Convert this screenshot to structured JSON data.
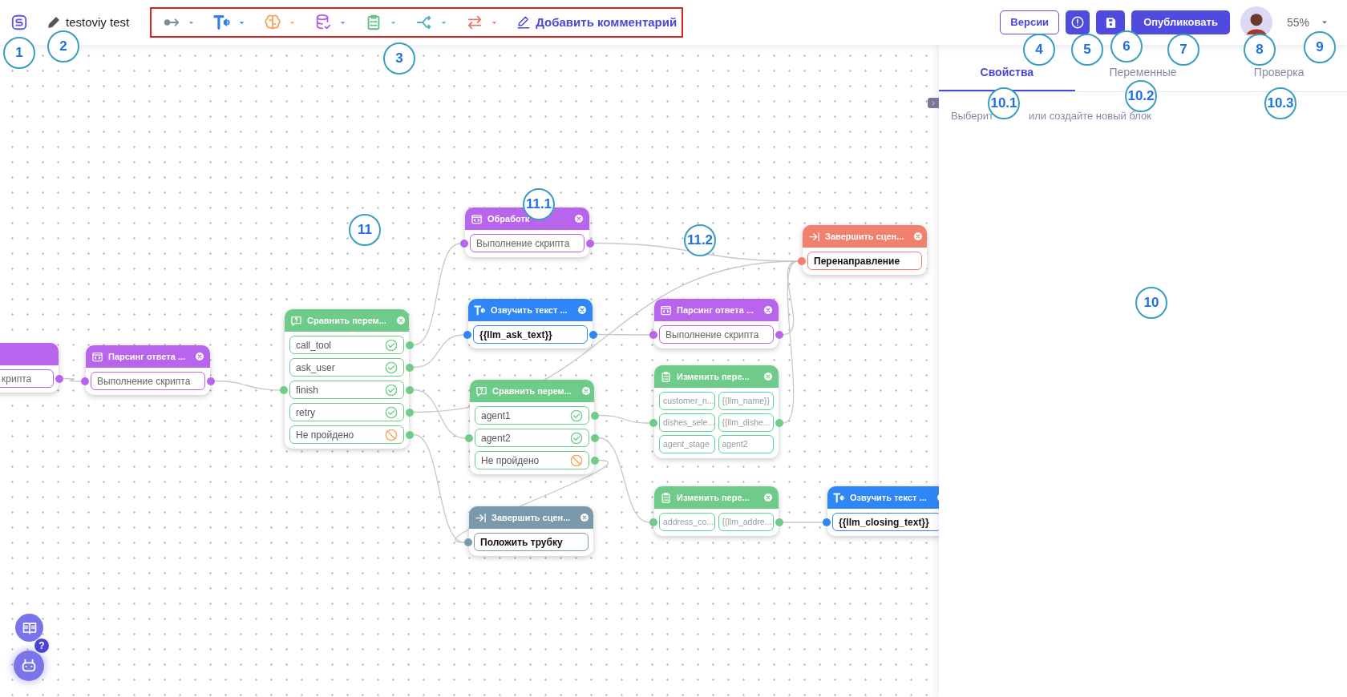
{
  "header": {
    "title": "testoviy test",
    "tools": [
      {
        "kind": "transfer",
        "color": "#78909c"
      },
      {
        "kind": "speak",
        "color": "#2f80ed"
      },
      {
        "kind": "ai",
        "color": "#f6a356"
      },
      {
        "kind": "database",
        "color": "#b35ee6"
      },
      {
        "kind": "variables",
        "color": "#5ec27e"
      },
      {
        "kind": "branch",
        "color": "#4aaec4"
      },
      {
        "kind": "switch",
        "color": "#f07469"
      }
    ],
    "comment_button": "Добавить комментарий",
    "versions_button": "Версии",
    "publish_button": "Опубликовать",
    "zoom": "55%"
  },
  "panel": {
    "tabs": [
      {
        "label": "Свойства",
        "selected": true
      },
      {
        "label": "Переменные",
        "selected": false
      },
      {
        "label": "Проверка",
        "selected": false
      }
    ],
    "hint": [
      "Выберит",
      "или создайте новый блок"
    ]
  },
  "nodes": [
    {
      "kind": "script",
      "color": "#b964ec",
      "fields": [
        "крипта"
      ]
    },
    {
      "kind": "script",
      "color": "#b964ec",
      "title": "Парсинг ответа ...",
      "fields": [
        "Выполнение скрипта"
      ]
    },
    {
      "kind": "compare",
      "color": "#6fcb8a",
      "title": "Сравнить перем...",
      "rows": [
        {
          "label": "call_tool",
          "kind": "match"
        },
        {
          "label": "ask_user",
          "kind": "match"
        },
        {
          "label": "finish",
          "kind": "match"
        },
        {
          "label": "retry",
          "kind": "match"
        },
        {
          "label": "Не пройдено",
          "kind": "fallback"
        }
      ]
    },
    {
      "kind": "script",
      "color": "#b964ec",
      "title": "Обработк",
      "fields": [
        "Выполнение скрипта"
      ]
    },
    {
      "kind": "speak",
      "color": "#2f86f6",
      "title": "Озвучить текст ...",
      "fields": [
        "{{llm_ask_text}}"
      ]
    },
    {
      "kind": "script",
      "color": "#b964ec",
      "title": "Парсинг ответа ...",
      "fields": [
        "Выполнение скрипта"
      ]
    },
    {
      "kind": "end",
      "color": "#f2806f",
      "title": "Завершить сцен...",
      "fields": [
        "Перенаправление"
      ]
    },
    {
      "kind": "compare",
      "color": "#6fcb8a",
      "title": "Сравнить перем...",
      "rows": [
        {
          "label": "agent1",
          "kind": "match"
        },
        {
          "label": "agent2",
          "kind": "match"
        },
        {
          "label": "Не пройдено",
          "kind": "fallback"
        }
      ]
    },
    {
      "kind": "set",
      "color": "#6fcb8a",
      "title": "Изменить пере...",
      "pairs": [
        {
          "name": "customer_n...",
          "value": "{{llm_name}}"
        },
        {
          "name": "dishes_sele...",
          "value": "{{llm_dishe..."
        },
        {
          "name": "agent_stage",
          "value": "agent2"
        }
      ]
    },
    {
      "kind": "set",
      "color": "#6fcb8a",
      "title": "Изменить пере...",
      "pairs": [
        {
          "name": "address_co...",
          "value": "{{llm_addre..."
        }
      ]
    },
    {
      "kind": "end",
      "color": "#7a9aab",
      "title": "Завершить сцен...",
      "fields": [
        "Положить трубку"
      ]
    },
    {
      "kind": "speak",
      "color": "#2f86f6",
      "title": "Озвучить текст ...",
      "fields": [
        "{{llm_closing_text}}"
      ]
    }
  ],
  "help_badge": "?",
  "callouts": [
    {
      "label": "1"
    },
    {
      "label": "2"
    },
    {
      "label": "3"
    },
    {
      "label": "4"
    },
    {
      "label": "5"
    },
    {
      "label": "6"
    },
    {
      "label": "7"
    },
    {
      "label": "8"
    },
    {
      "label": "9"
    },
    {
      "label": "10.1"
    },
    {
      "label": "10.2"
    },
    {
      "label": "10.3"
    },
    {
      "label": "10"
    },
    {
      "label": "11"
    },
    {
      "label": "11.1"
    },
    {
      "label": "11.2"
    }
  ]
}
